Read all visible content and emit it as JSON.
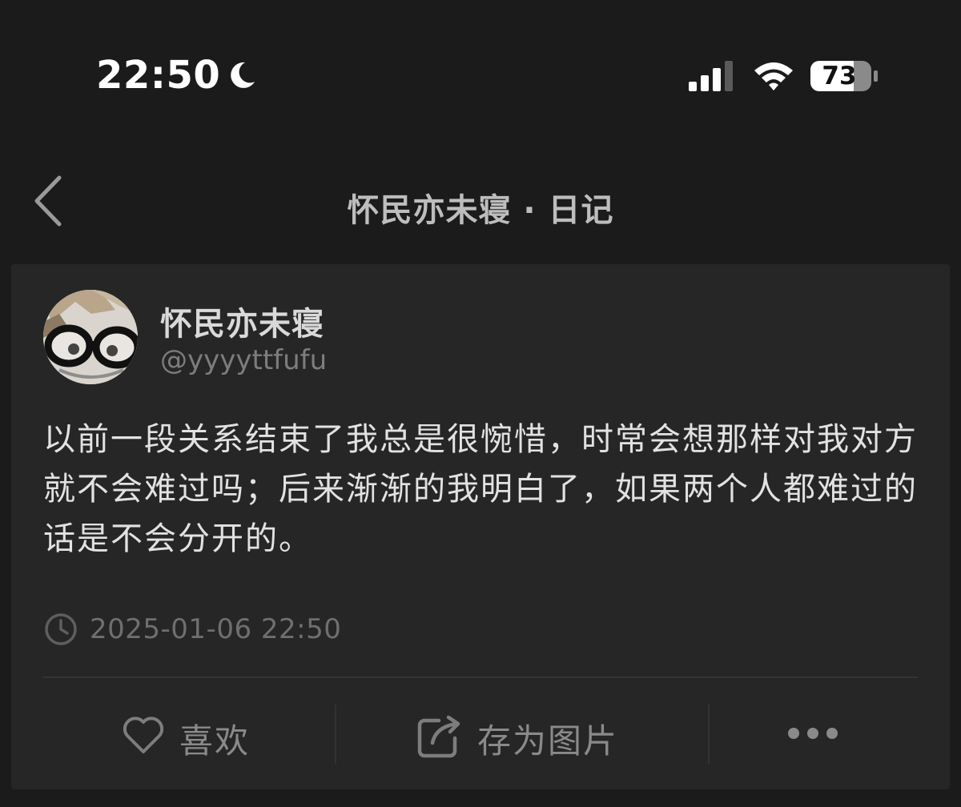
{
  "status_bar": {
    "time": "22:50",
    "battery_level": "73",
    "focus_mode_icon": "moon-icon",
    "cellular_bars_active": 3,
    "cellular_bars_total": 4
  },
  "nav": {
    "back_icon": "chevron-left-icon",
    "title": "怀民亦未寝 · 日记"
  },
  "post": {
    "author_name": "怀民亦未寝",
    "author_handle": "@yyyyttfufu",
    "text": "以前一段关系结束了我总是很惋惜，时常会想那样对我对方就不会难过吗；后来渐渐的我明白了，如果两个人都难过的话是不会分开的。",
    "timestamp": "2025-01-06 22:50"
  },
  "actions": {
    "like_label": "喜欢",
    "save_label": "存为图片",
    "more_icon": "more-dots-icon"
  },
  "colors": {
    "background": "#1b1b1b",
    "card": "#262626",
    "text_primary": "#e2e2e2",
    "text_muted": "#7d7d7d"
  }
}
